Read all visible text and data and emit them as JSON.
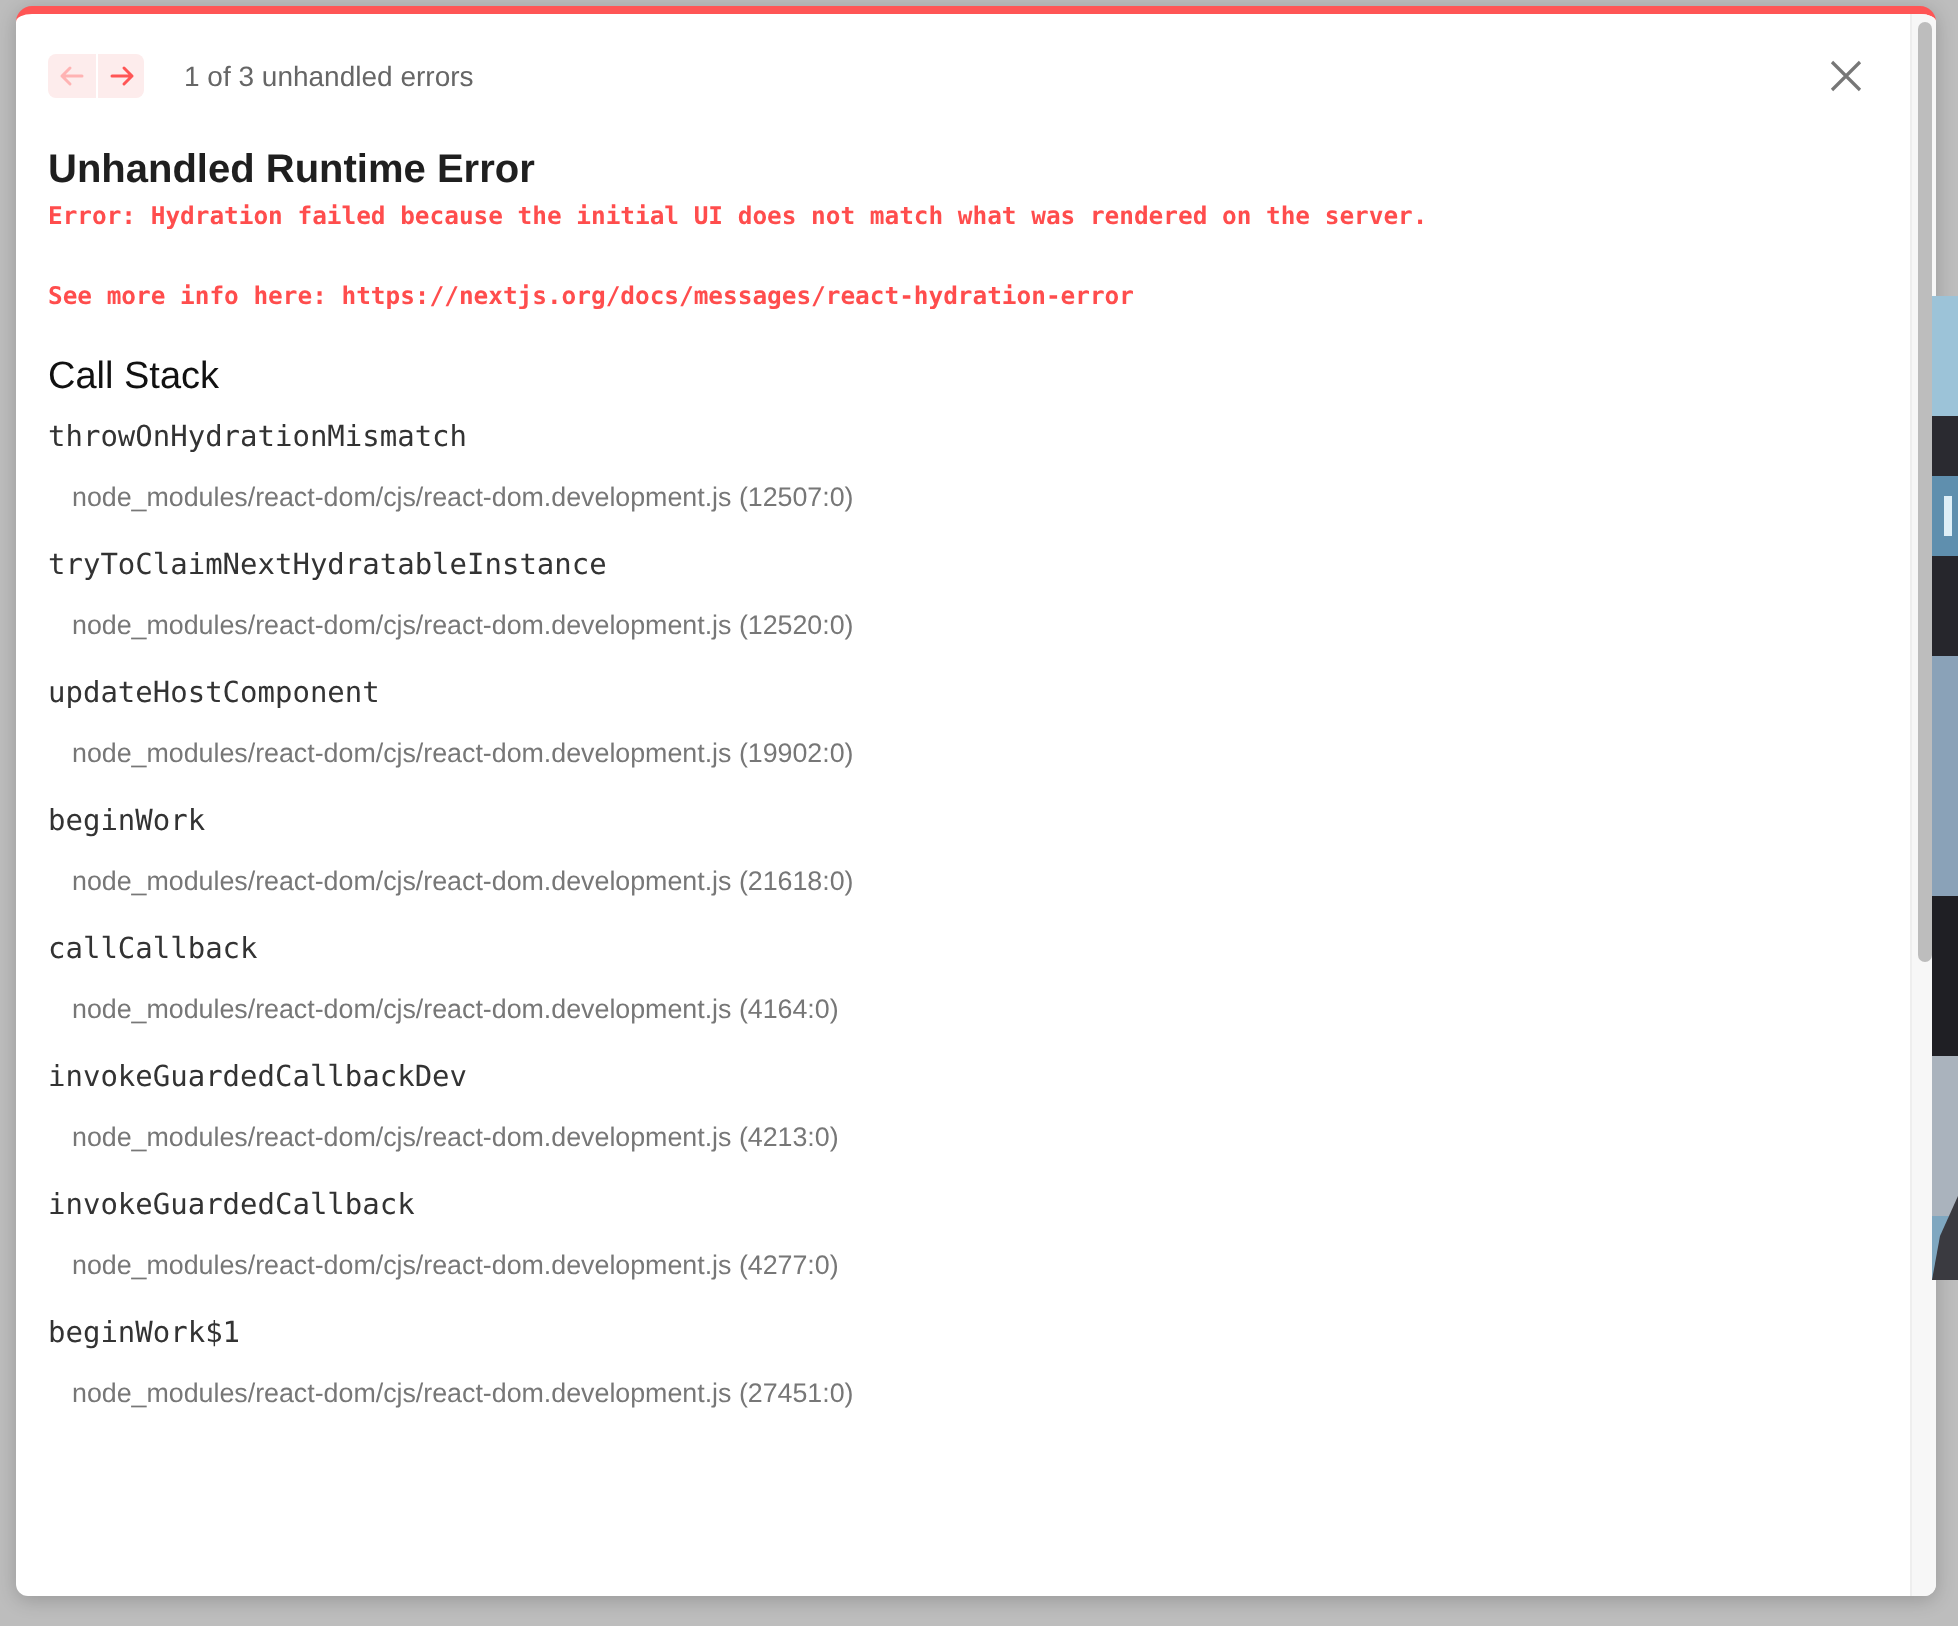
{
  "dialog": {
    "pager": {
      "buttons": [
        {
          "kind": "previous",
          "disabled": true
        },
        {
          "kind": "next",
          "disabled": false
        }
      ],
      "label": "1 of 3 unhandled errors"
    },
    "title": "Unhandled Runtime Error",
    "message": "Error: Hydration failed because the initial UI does not match what was rendered on the server.\n\nSee more info here: https://nextjs.org/docs/messages/react-hydration-error",
    "call_stack": {
      "heading": "Call Stack",
      "frames": [
        {
          "function": "throwOnHydrationMismatch",
          "location": "node_modules/react-dom/cjs/react-dom.development.js (12507:0)"
        },
        {
          "function": "tryToClaimNextHydratableInstance",
          "location": "node_modules/react-dom/cjs/react-dom.development.js (12520:0)"
        },
        {
          "function": "updateHostComponent",
          "location": "node_modules/react-dom/cjs/react-dom.development.js (19902:0)"
        },
        {
          "function": "beginWork",
          "location": "node_modules/react-dom/cjs/react-dom.development.js (21618:0)"
        },
        {
          "function": "callCallback",
          "location": "node_modules/react-dom/cjs/react-dom.development.js (4164:0)"
        },
        {
          "function": "invokeGuardedCallbackDev",
          "location": "node_modules/react-dom/cjs/react-dom.development.js (4213:0)"
        },
        {
          "function": "invokeGuardedCallback",
          "location": "node_modules/react-dom/cjs/react-dom.development.js (4277:0)"
        },
        {
          "function": "beginWork$1",
          "location": "node_modules/react-dom/cjs/react-dom.development.js (27451:0)"
        }
      ]
    }
  }
}
